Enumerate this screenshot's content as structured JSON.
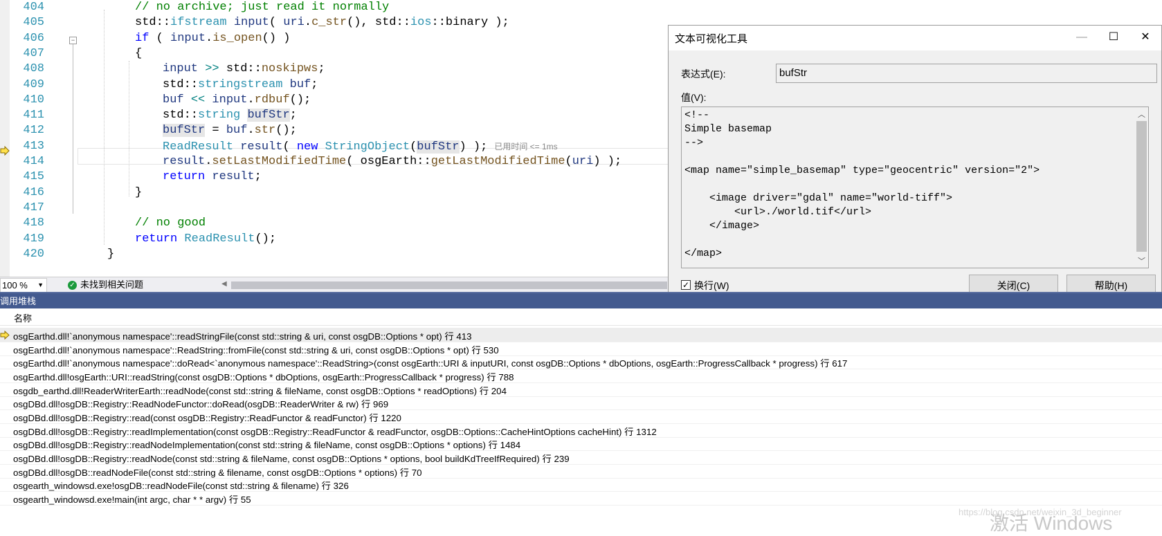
{
  "editor": {
    "lines": [
      {
        "num": "404",
        "tokens": [
          {
            "t": "// no archive; just read it normally",
            "c": "cm"
          }
        ]
      },
      {
        "num": "405",
        "tokens": [
          {
            "t": "std::",
            "c": "ns"
          },
          {
            "t": "ifstream",
            "c": "ty"
          },
          {
            "t": " ",
            "c": "ns"
          },
          {
            "t": "input",
            "c": "vr"
          },
          {
            "t": "( ",
            "c": "ns"
          },
          {
            "t": "uri",
            "c": "vr"
          },
          {
            "t": ".",
            "c": "ns"
          },
          {
            "t": "c_str",
            "c": "fn"
          },
          {
            "t": "(), std::",
            "c": "ns"
          },
          {
            "t": "ios",
            "c": "ty"
          },
          {
            "t": "::binary );",
            "c": "ns"
          }
        ]
      },
      {
        "num": "406",
        "tokens": [
          {
            "t": "if",
            "c": "kw"
          },
          {
            "t": " ( ",
            "c": "ns"
          },
          {
            "t": "input",
            "c": "vr"
          },
          {
            "t": ".",
            "c": "ns"
          },
          {
            "t": "is_open",
            "c": "fn"
          },
          {
            "t": "() )",
            "c": "ns"
          }
        ]
      },
      {
        "num": "407",
        "tokens": [
          {
            "t": "{",
            "c": "ns"
          }
        ]
      },
      {
        "num": "408",
        "tokens": [
          {
            "t": "input",
            "c": "vr"
          },
          {
            "t": " ",
            "c": "ns"
          },
          {
            "t": ">>",
            "c": "op"
          },
          {
            "t": " std::",
            "c": "ns"
          },
          {
            "t": "noskipws",
            "c": "fn"
          },
          {
            "t": ";",
            "c": "ns"
          }
        ]
      },
      {
        "num": "409",
        "tokens": [
          {
            "t": "std::",
            "c": "ns"
          },
          {
            "t": "stringstream",
            "c": "ty"
          },
          {
            "t": " ",
            "c": "ns"
          },
          {
            "t": "buf",
            "c": "vr"
          },
          {
            "t": ";",
            "c": "ns"
          }
        ]
      },
      {
        "num": "410",
        "tokens": [
          {
            "t": "buf",
            "c": "vr"
          },
          {
            "t": " ",
            "c": "ns"
          },
          {
            "t": "<<",
            "c": "op"
          },
          {
            "t": " ",
            "c": "ns"
          },
          {
            "t": "input",
            "c": "vr"
          },
          {
            "t": ".",
            "c": "ns"
          },
          {
            "t": "rdbuf",
            "c": "fn"
          },
          {
            "t": "();",
            "c": "ns"
          }
        ]
      },
      {
        "num": "411",
        "tokens": [
          {
            "t": "std::",
            "c": "ns"
          },
          {
            "t": "string",
            "c": "ty"
          },
          {
            "t": " ",
            "c": "ns"
          },
          {
            "t": "bufStr",
            "c": "vr hl"
          },
          {
            "t": ";",
            "c": "ns"
          }
        ]
      },
      {
        "num": "412",
        "tokens": [
          {
            "t": "bufStr",
            "c": "vr hl"
          },
          {
            "t": " = ",
            "c": "ns"
          },
          {
            "t": "buf",
            "c": "vr"
          },
          {
            "t": ".",
            "c": "ns"
          },
          {
            "t": "str",
            "c": "fn"
          },
          {
            "t": "();",
            "c": "ns"
          }
        ]
      },
      {
        "num": "413",
        "tokens": [
          {
            "t": "ReadResult",
            "c": "ty"
          },
          {
            "t": " ",
            "c": "ns"
          },
          {
            "t": "result",
            "c": "vr"
          },
          {
            "t": "( ",
            "c": "ns"
          },
          {
            "t": "new",
            "c": "kw"
          },
          {
            "t": " ",
            "c": "ns"
          },
          {
            "t": "StringObject",
            "c": "ty"
          },
          {
            "t": "(",
            "c": "ns"
          },
          {
            "t": "bufStr",
            "c": "vr hl"
          },
          {
            "t": ") );",
            "c": "ns"
          }
        ],
        "elapsed": "已用时间 <= 1ms"
      },
      {
        "num": "414",
        "tokens": [
          {
            "t": "result",
            "c": "vr"
          },
          {
            "t": ".",
            "c": "ns"
          },
          {
            "t": "setLastModifiedTime",
            "c": "fn"
          },
          {
            "t": "( osgEarth::",
            "c": "ns"
          },
          {
            "t": "getLastModifiedTime",
            "c": "fn"
          },
          {
            "t": "(",
            "c": "ns"
          },
          {
            "t": "uri",
            "c": "vr"
          },
          {
            "t": ") );",
            "c": "ns"
          }
        ]
      },
      {
        "num": "415",
        "tokens": [
          {
            "t": "return",
            "c": "kw"
          },
          {
            "t": " ",
            "c": "ns"
          },
          {
            "t": "result",
            "c": "vr"
          },
          {
            "t": ";",
            "c": "ns"
          }
        ]
      },
      {
        "num": "416",
        "tokens": [
          {
            "t": "}",
            "c": "ns"
          }
        ]
      },
      {
        "num": "417",
        "tokens": []
      },
      {
        "num": "418",
        "tokens": [
          {
            "t": "// no good",
            "c": "cm"
          }
        ]
      },
      {
        "num": "419",
        "tokens": [
          {
            "t": "return",
            "c": "kw"
          },
          {
            "t": " ",
            "c": "ns"
          },
          {
            "t": "ReadResult",
            "c": "ty"
          },
          {
            "t": "();",
            "c": "ns"
          }
        ]
      },
      {
        "num": "420",
        "tokens": [
          {
            "t": "}",
            "c": "ns"
          }
        ]
      }
    ],
    "current_line": "413",
    "zoom": "100 %",
    "status": "未找到相关问题"
  },
  "dialog": {
    "title": "文本可视化工具",
    "expression_label": "表达式(E):",
    "expression_value": "bufStr",
    "value_label": "值(V):",
    "value_text": "<!--\nSimple basemap\n-->\n\n<map name=\"simple_basemap\" type=\"geocentric\" version=\"2\">\n\n    <image driver=\"gdal\" name=\"world-tiff\">\n        <url>./world.tif</url>\n    </image>\n\n</map>",
    "wrap_label": "换行(W)",
    "wrap_checked": true,
    "close_button": "关闭(C)",
    "help_button": "帮助(H)"
  },
  "callstack": {
    "title": "调用堆栈",
    "column_name": "名称",
    "rows": [
      "osgEarthd.dll!`anonymous namespace'::readStringFile(const std::string & uri, const osgDB::Options * opt) 行 413",
      "osgEarthd.dll!`anonymous namespace'::ReadString::fromFile(const std::string & uri, const osgDB::Options * opt) 行 530",
      "osgEarthd.dll!`anonymous namespace'::doRead<`anonymous namespace'::ReadString>(const osgEarth::URI & inputURI, const osgDB::Options * dbOptions, osgEarth::ProgressCallback * progress) 行 617",
      "osgEarthd.dll!osgEarth::URI::readString(const osgDB::Options * dbOptions, osgEarth::ProgressCallback * progress) 行 788",
      "osgdb_earthd.dll!ReaderWriterEarth::readNode(const std::string & fileName, const osgDB::Options * readOptions) 行 204",
      "osgDBd.dll!osgDB::Registry::ReadNodeFunctor::doRead(osgDB::ReaderWriter & rw) 行 969",
      "osgDBd.dll!osgDB::Registry::read(const osgDB::Registry::ReadFunctor & readFunctor) 行 1220",
      "osgDBd.dll!osgDB::Registry::readImplementation(const osgDB::Registry::ReadFunctor & readFunctor, osgDB::Options::CacheHintOptions cacheHint) 行 1312",
      "osgDBd.dll!osgDB::Registry::readNodeImplementation(const std::string & fileName, const osgDB::Options * options) 行 1484",
      "osgDBd.dll!osgDB::Registry::readNode(const std::string & fileName, const osgDB::Options * options, bool buildKdTreeIfRequired) 行 239",
      "osgDBd.dll!osgDB::readNodeFile(const std::string & filename, const osgDB::Options * options) 行 70",
      "osgearth_windowsd.exe!osgDB::readNodeFile(const std::string & filename) 行 326",
      "osgearth_windowsd.exe!main(int argc, char * * argv) 行 55"
    ],
    "active_row": 0
  },
  "watermark": {
    "activate_text": "激活 Windows",
    "url_text": "https://blog.csdn.net/weixin_3d_beginner"
  },
  "colors": {
    "accent": "#435a8f",
    "keyword": "#0000ff",
    "type": "#2b91af",
    "comment": "#008000"
  }
}
